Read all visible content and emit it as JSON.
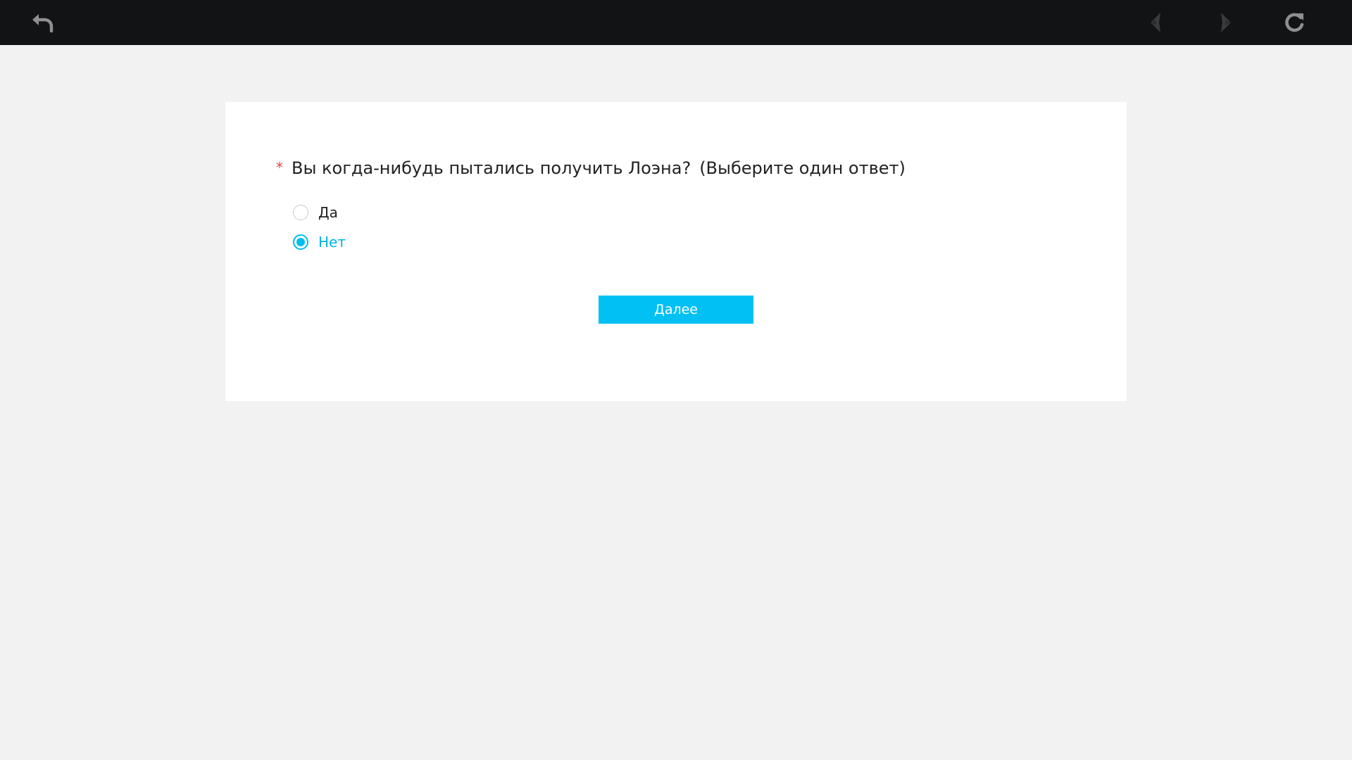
{
  "toolbar": {
    "back_icon": "back-arrow-icon",
    "prev_icon": "chevron-left-icon",
    "next_icon": "chevron-right-icon",
    "reload_icon": "reload-icon"
  },
  "question": {
    "required_mark": "*",
    "text": "Вы когда-нибудь пытались получить Лоэна?",
    "hint": "(Выберите один ответ)",
    "options": [
      {
        "label": "Да",
        "selected": false
      },
      {
        "label": "Нет",
        "selected": true
      }
    ]
  },
  "actions": {
    "next_label": "Далее"
  },
  "colors": {
    "accent": "#00c0f4",
    "required": "#e04848",
    "topbar": "#121315",
    "background": "#f2f2f2"
  }
}
